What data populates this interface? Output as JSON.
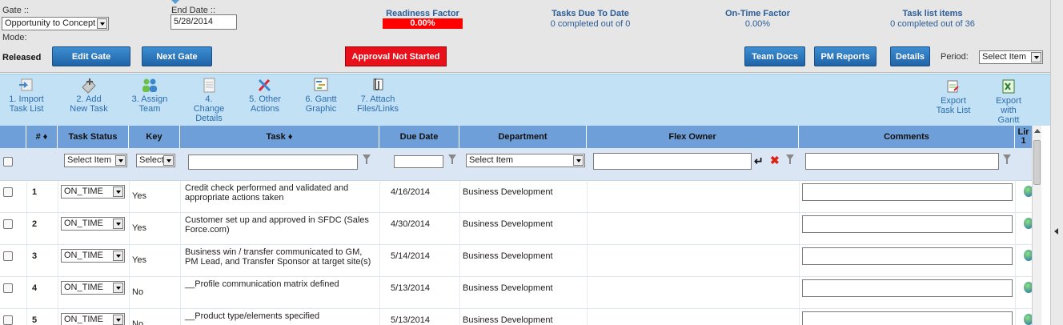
{
  "header": {
    "gate_label": "Gate ::",
    "gate_value": "Opportunity to Concept",
    "mode_label": "Mode:",
    "released_label": "Released",
    "end_date_label": "End Date ::",
    "end_date_value": "5/28/2014",
    "readiness": {
      "label": "Readiness Factor",
      "value": "0.00%"
    },
    "tasks_due": {
      "label": "Tasks Due To Date",
      "value": "0  completed out of  0"
    },
    "on_time": {
      "label": "On-Time Factor",
      "value": "0.00%"
    },
    "task_list": {
      "label": "Task list items",
      "value": "0  completed out of  36"
    },
    "buttons": {
      "edit_gate": "Edit Gate",
      "next_gate": "Next Gate",
      "approval": "Approval Not Started",
      "team_docs": "Team Docs",
      "pm_reports": "PM Reports",
      "details": "Details"
    },
    "period_label": "Period:",
    "period_value": "Select Item"
  },
  "toolbar": {
    "import": [
      "1. Import",
      "Task List"
    ],
    "add": [
      "2. Add",
      "New Task"
    ],
    "assign": [
      "3. Assign",
      "Team"
    ],
    "change": [
      "4.",
      "Change",
      "Details"
    ],
    "other": [
      "5. Other",
      "Actions"
    ],
    "gantt": [
      "6. Gantt",
      "Graphic"
    ],
    "attach": [
      "7. Attach",
      "Files/Links"
    ],
    "export_task": [
      "Export",
      "Task List"
    ],
    "export_gantt": [
      "Export",
      "with",
      "Gantt"
    ]
  },
  "table": {
    "headers": {
      "num": "# ♦",
      "status": "Task Status",
      "key": "Key",
      "task": "Task ♦",
      "due": "Due Date",
      "dept": "Department",
      "owner": "Flex Owner",
      "comments": "Comments",
      "extra": "Lir 1"
    },
    "filter": {
      "status": "Select Item",
      "key": "Select",
      "dept": "Select Item"
    },
    "rows": [
      {
        "num": "1",
        "status": "ON_TIME",
        "key": "Yes",
        "task": "Credit check performed and validated and appropriate actions taken",
        "due": "4/16/2014",
        "dept": "Business Development"
      },
      {
        "num": "2",
        "status": "ON_TIME",
        "key": "Yes",
        "task": "Customer set up and approved in SFDC (Sales Force.com)",
        "due": "4/30/2014",
        "dept": "Business Development"
      },
      {
        "num": "3",
        "status": "ON_TIME",
        "key": "Yes",
        "task": "Business win / transfer communicated to GM, PM Lead, and Transfer Sponsor at target site(s)",
        "due": "5/14/2014",
        "dept": "Business Development"
      },
      {
        "num": "4",
        "status": "ON_TIME",
        "key": "No",
        "task": "__Profile communication matrix defined",
        "due": "5/13/2014",
        "dept": "Business Development"
      },
      {
        "num": "5",
        "status": "ON_TIME",
        "key": "No",
        "task": "__Product type/elements specified",
        "due": "5/13/2014",
        "dept": "Business Development"
      }
    ]
  },
  "colors": {
    "readiness": "#ff0000",
    "approval": "#e8101a",
    "button_blue": "#2a74bd",
    "toolbar": "#c3e1f4",
    "table_header": "#6e9fd9"
  }
}
